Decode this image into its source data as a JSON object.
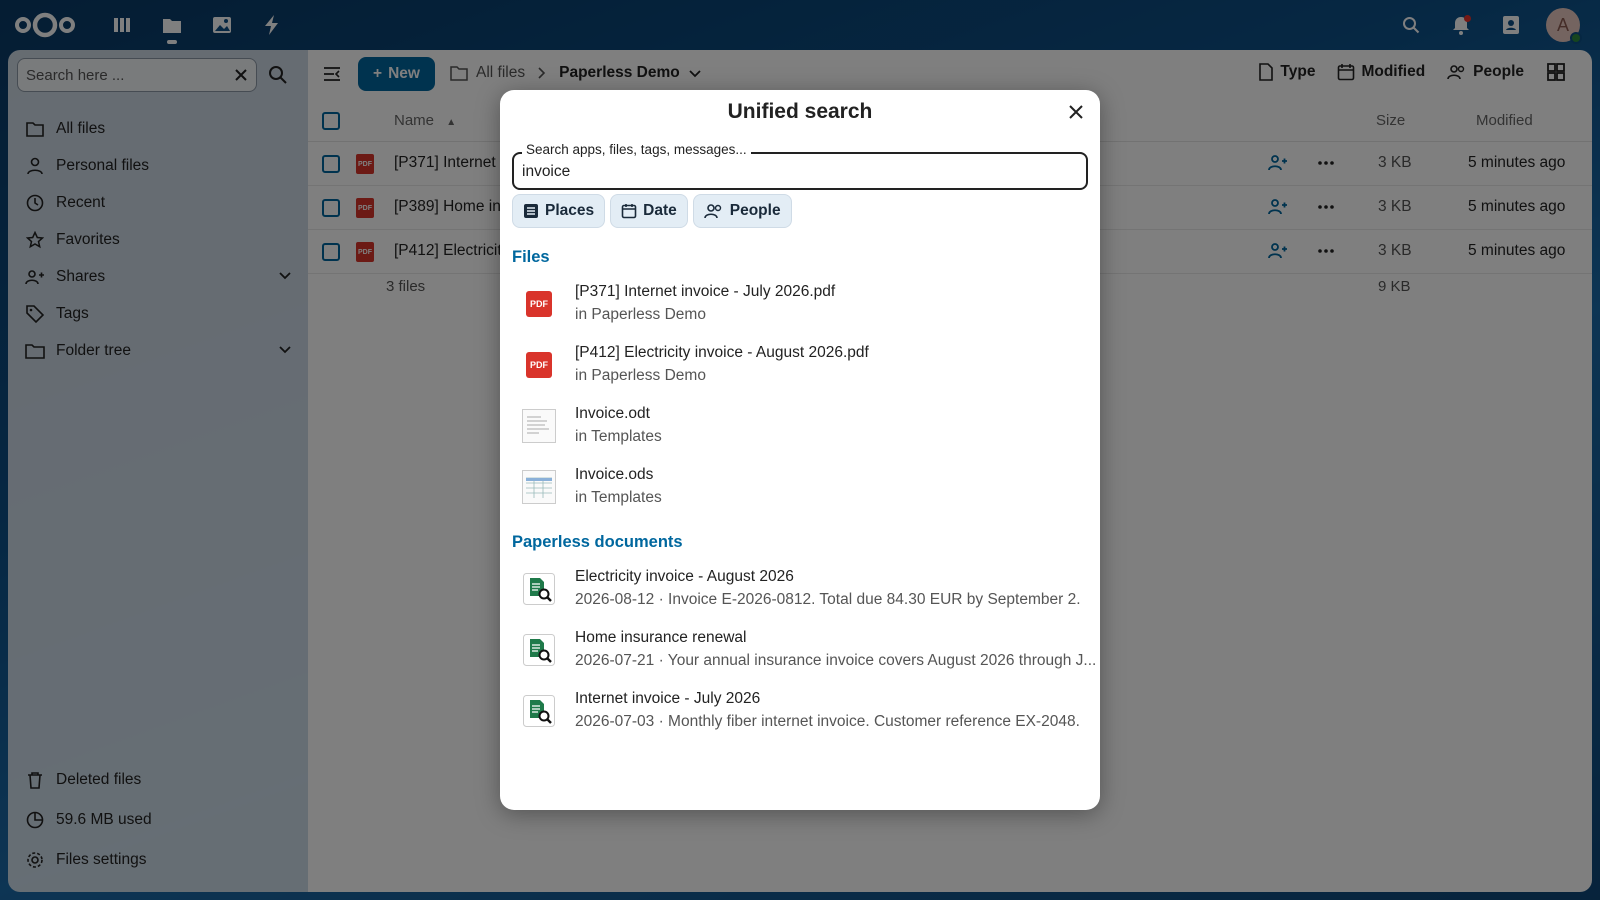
{
  "header": {
    "apps": [
      "dashboard-icon",
      "files-icon",
      "photos-icon",
      "activity-icon"
    ],
    "right": [
      "search-icon",
      "bell-icon",
      "contacts-icon"
    ],
    "avatar_letter": "A"
  },
  "sidebar": {
    "search_placeholder": "Search here ...",
    "items": [
      {
        "label": "All files",
        "icon": "folder-icon"
      },
      {
        "label": "Personal files",
        "icon": "user-icon"
      },
      {
        "label": "Recent",
        "icon": "clock-icon"
      },
      {
        "label": "Favorites",
        "icon": "star-icon"
      },
      {
        "label": "Shares",
        "icon": "share-icon"
      },
      {
        "label": "Tags",
        "icon": "tag-icon"
      },
      {
        "label": "Folder tree",
        "icon": "folder-tree-icon"
      }
    ],
    "bottom": {
      "deleted": "Deleted files",
      "quota": "59.6 MB used",
      "settings": "Files settings"
    }
  },
  "toolbar": {
    "new_label": "New",
    "breadcrumb_root": "All files",
    "breadcrumb_current": "Paperless Demo",
    "filter_type": "Type",
    "filter_modified": "Modified",
    "filter_people": "People"
  },
  "table": {
    "col_name": "Name",
    "col_size": "Size",
    "col_modified": "Modified",
    "rows": [
      {
        "name": "[P371] Internet",
        "size": "3 KB",
        "modified": "5 minutes ago"
      },
      {
        "name": "[P389] Home in",
        "size": "3 KB",
        "modified": "5 minutes ago"
      },
      {
        "name": "[P412] Electricit",
        "size": "3 KB",
        "modified": "5 minutes ago"
      }
    ],
    "summary_count": "3 files",
    "summary_size": "9 KB"
  },
  "search_modal": {
    "title": "Unified search",
    "field_label": "Search apps, files, tags, messages...",
    "query": "invoice",
    "chips": {
      "places": "Places",
      "date": "Date",
      "people": "People"
    },
    "files_title": "Files",
    "files": [
      {
        "title": "[P371] Internet invoice - July 2026.pdf",
        "subtitle": "in Paperless Demo",
        "kind": "pdf"
      },
      {
        "title": "[P412] Electricity invoice - August 2026.pdf",
        "subtitle": "in Paperless Demo",
        "kind": "pdf"
      },
      {
        "title": "Invoice.odt",
        "subtitle": "in Templates",
        "kind": "odt"
      },
      {
        "title": "Invoice.ods",
        "subtitle": "in Templates",
        "kind": "ods"
      }
    ],
    "paperless_title": "Paperless documents",
    "paperless": [
      {
        "title": "Electricity invoice - August 2026",
        "subtitle": "2026-08-12 · Invoice E-2026-0812. Total due 84.30 EUR by September 2."
      },
      {
        "title": "Home insurance renewal",
        "subtitle": "2026-07-21 · Your annual insurance invoice covers August 2026 through J..."
      },
      {
        "title": "Internet invoice - July 2026",
        "subtitle": "2026-07-03 · Monthly fiber internet invoice. Customer reference EX-2048."
      }
    ]
  },
  "colors": {
    "primary": "#00679e",
    "pdf": "#d9342b",
    "doc_search": "#1f7a4a"
  }
}
